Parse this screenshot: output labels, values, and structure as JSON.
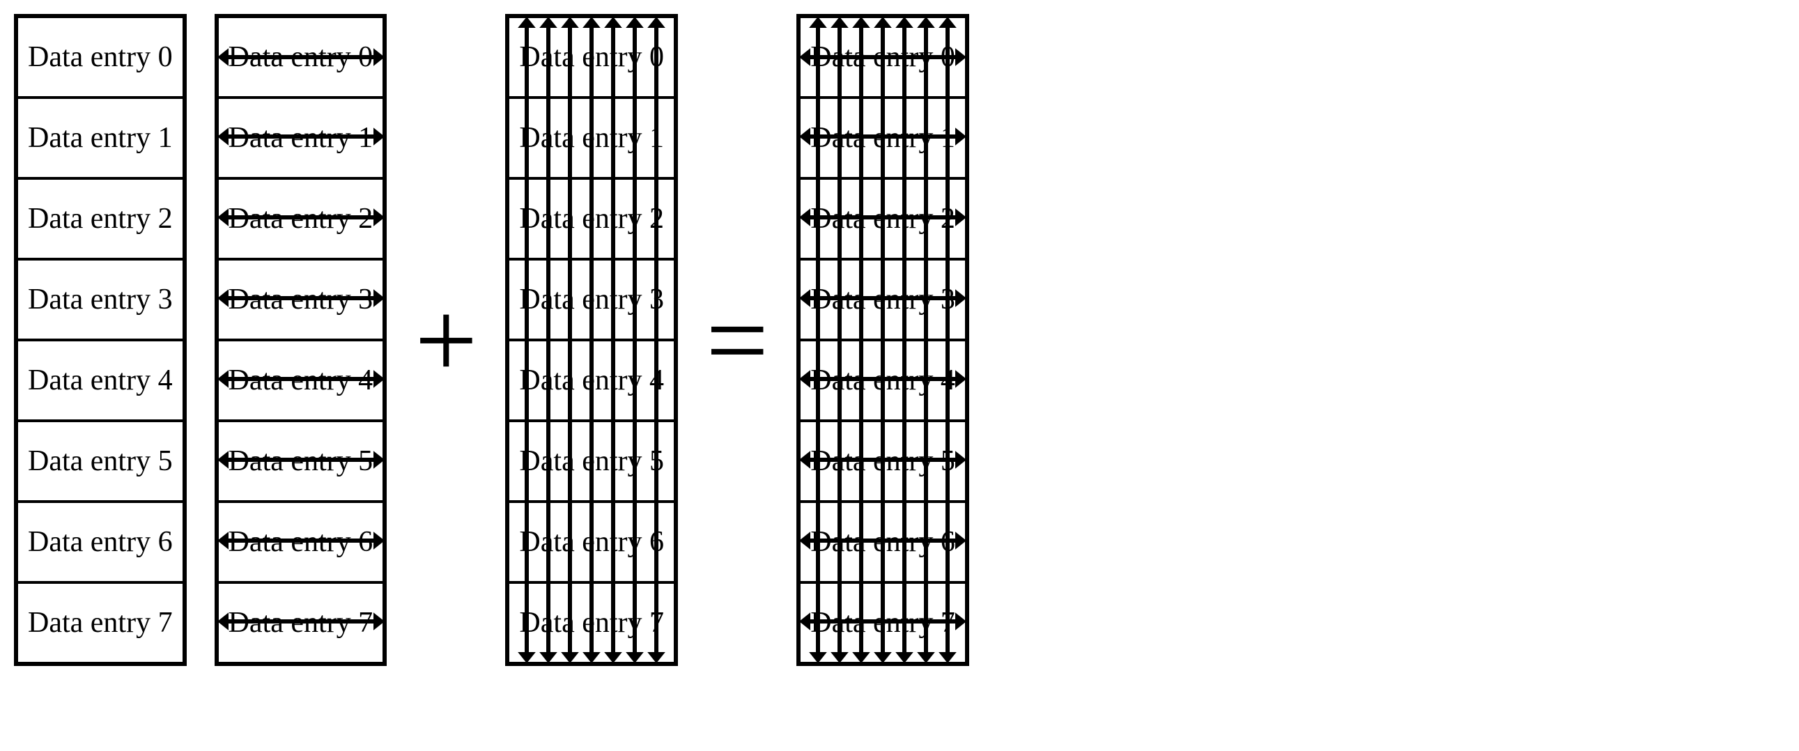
{
  "diagram": {
    "entries": [
      "Data entry 0",
      "Data entry 1",
      "Data entry 2",
      "Data entry 3",
      "Data entry 4",
      "Data entry 5",
      "Data entry 6",
      "Data entry 7"
    ],
    "operator_plus": "+",
    "operator_equals": "=",
    "columns": [
      {
        "id": "plain",
        "horizontal_arrows": false,
        "vertical_arrows": false
      },
      {
        "id": "horizontal",
        "horizontal_arrows": true,
        "vertical_arrows": false
      },
      {
        "id": "vertical",
        "horizontal_arrows": false,
        "vertical_arrows": true
      },
      {
        "id": "both",
        "horizontal_arrows": true,
        "vertical_arrows": true
      }
    ],
    "vertical_arrow_count": 7
  }
}
